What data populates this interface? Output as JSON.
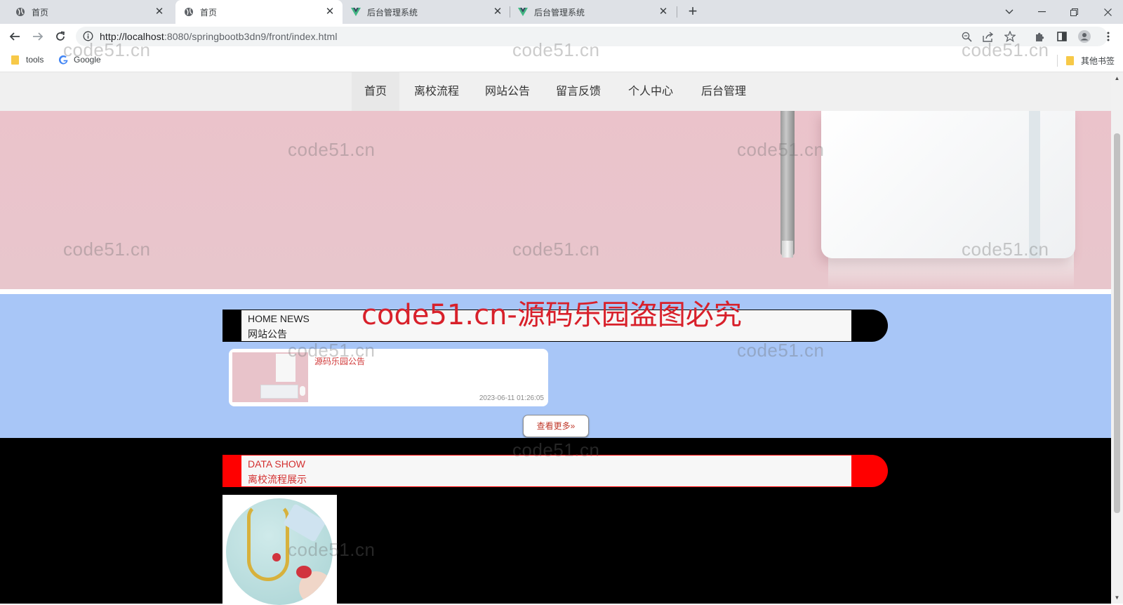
{
  "browser": {
    "tabs": [
      {
        "label": "首页",
        "icon": "globe-icon",
        "active": false
      },
      {
        "label": "首页",
        "icon": "globe-icon",
        "active": true
      },
      {
        "label": "后台管理系统",
        "icon": "vue-logo-icon",
        "active": false
      },
      {
        "label": "后台管理系统",
        "icon": "vue-logo-icon",
        "active": false
      }
    ],
    "url_host": "http://localhost",
    "url_rest": ":8080/springbootb3dn9/front/index.html",
    "bookmarks": [
      {
        "label": "tools",
        "icon": "folder-icon"
      },
      {
        "label": "Google",
        "icon": "google-icon"
      }
    ],
    "other_bookmarks": "其他书签"
  },
  "nav": {
    "items": [
      "首页",
      "离校流程",
      "网站公告",
      "留言反馈",
      "个人中心",
      "后台管理"
    ],
    "active_index": 0
  },
  "news_section": {
    "title_en": "HOME NEWS",
    "title_zh": "网站公告",
    "items": [
      {
        "title": "源码乐园公告",
        "date": "2023-06-11 01:26:05"
      }
    ],
    "more_button": "查看更多»"
  },
  "data_section": {
    "title_en": "DATA SHOW",
    "title_zh": "离校流程展示"
  },
  "watermark": {
    "text": "code51.cn",
    "big_text": "code51.cn-源码乐园盗图必究"
  },
  "colors": {
    "news_bg": "#a8c6f7",
    "data_bg": "#000000",
    "accent_red": "#ff0000",
    "banner_pink": "#ebc3cb"
  }
}
